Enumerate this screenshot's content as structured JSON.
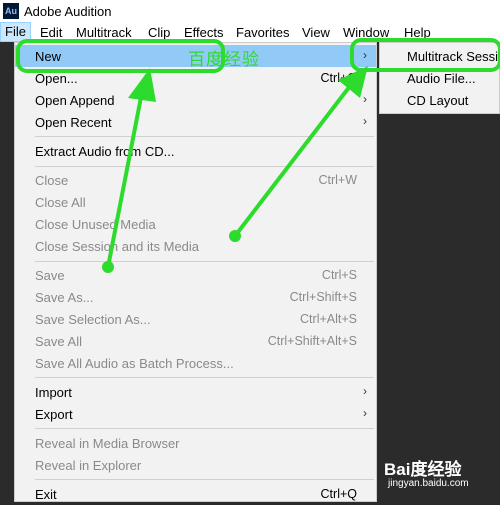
{
  "app": {
    "title": "Adobe Audition",
    "icon_text": "Au"
  },
  "menubar": [
    "File",
    "Edit",
    "Multitrack",
    "Clip",
    "Effects",
    "Favorites",
    "View",
    "Window",
    "Help"
  ],
  "file_menu": {
    "new": "New",
    "open": "Open...",
    "open_shortcut": "Ctrl+O",
    "open_append": "Open Append",
    "open_recent": "Open Recent",
    "extract_audio": "Extract Audio from CD...",
    "close": "Close",
    "close_shortcut": "Ctrl+W",
    "close_all": "Close All",
    "close_unused": "Close Unused Media",
    "close_session": "Close Session and its Media",
    "save": "Save",
    "save_shortcut": "Ctrl+S",
    "save_as": "Save As...",
    "save_as_shortcut": "Ctrl+Shift+S",
    "save_selection": "Save Selection As...",
    "save_selection_shortcut": "Ctrl+Alt+S",
    "save_all": "Save All",
    "save_all_shortcut": "Ctrl+Shift+Alt+S",
    "save_all_batch": "Save All Audio as Batch Process...",
    "import": "Import",
    "export": "Export",
    "reveal_browser": "Reveal in Media Browser",
    "reveal_explorer": "Reveal in Explorer",
    "exit": "Exit",
    "exit_shortcut": "Ctrl+Q"
  },
  "new_submenu": [
    "Multitrack Session...",
    "Audio File...",
    "CD Layout"
  ],
  "watermark": {
    "text": "百度经验",
    "logo": "Bai度经验",
    "url": "jingyan.baidu.com"
  },
  "colors": {
    "annotation": "#2ddb2d",
    "highlight": "#91c9f7"
  }
}
